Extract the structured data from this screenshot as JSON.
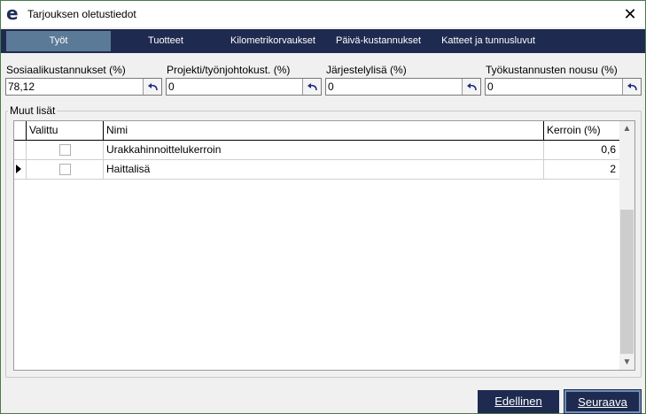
{
  "window": {
    "title": "Tarjouksen oletustiedot",
    "close_glyph": "✕",
    "logo_glyph": "e"
  },
  "tabs": [
    {
      "label": "Työt",
      "active": true
    },
    {
      "label": "Tuotteet",
      "active": false
    },
    {
      "label": "Kilometrikorvaukset",
      "active": false
    },
    {
      "label": "Päivä-kustannukset",
      "active": false
    },
    {
      "label": "Katteet ja tunnusluvut",
      "active": false
    }
  ],
  "fields": [
    {
      "label": "Sosiaalikustannukset (%)",
      "value": "78,12"
    },
    {
      "label": "Projekti/työnjohtokust. (%)",
      "value": "0"
    },
    {
      "label": "Järjestelylisä (%)",
      "value": "0"
    },
    {
      "label": "Työkustannusten nousu (%)",
      "value": "0"
    }
  ],
  "group": {
    "label": "Muut lisät",
    "columns": {
      "selected": "Valittu",
      "name": "Nimi",
      "factor": "Kerroin (%)"
    },
    "rows": [
      {
        "selected": false,
        "name": "Urakkahinnoittelukerroin",
        "factor": "0,6",
        "current": false
      },
      {
        "selected": false,
        "name": "Haittalisä",
        "factor": "2",
        "current": true
      }
    ]
  },
  "buttons": {
    "previous": "Edellinen",
    "next": "Seuraava"
  },
  "colors": {
    "tabbar": "#1e2a4f",
    "tab_active": "#5b7a98",
    "button": "#1e2a4f"
  },
  "icons": {
    "reset": "undo-arrow-icon",
    "scroll_up": "chevron-up-icon",
    "scroll_down": "chevron-down-icon"
  }
}
